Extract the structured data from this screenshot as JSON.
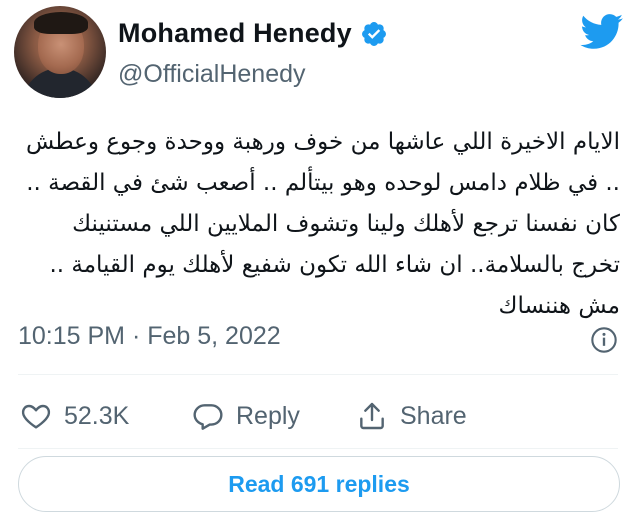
{
  "tweet": {
    "author": {
      "name": "Mohamed Henedy",
      "handle": "@OfficialHenedy",
      "verified": true
    },
    "text": "الايام الاخيرة اللي عاشها من خوف ورهبة ووحدة وجوع وعطش .. في ظلام دامس لوحده وهو بيتألم .. أصعب شئ في القصة .. كان نفسنا ترجع لأهلك ولينا وتشوف الملايين اللي مستنينك تخرج بالسلامة.. ان شاء الله تكون شفيع لأهلك يوم القيامة .. مش هننساك",
    "timestamp": "10:15 PM · Feb 5, 2022",
    "likes": "52.3K",
    "reply_label": "Reply",
    "share_label": "Share",
    "read_replies_label": "Read 691 replies"
  },
  "colors": {
    "accent": "#1d9bf0",
    "text": "#0f1419",
    "secondary": "#536471",
    "border": "#cfd9de"
  },
  "icons": {
    "verified": "verified-badge-icon",
    "brand": "twitter-bird-icon",
    "info": "info-icon",
    "like": "heart-icon",
    "reply": "comment-bubble-icon",
    "share": "share-upload-icon"
  }
}
